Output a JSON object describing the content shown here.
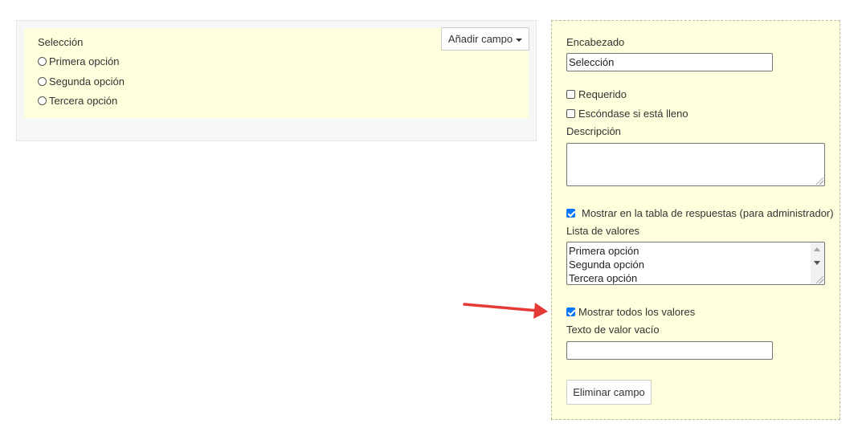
{
  "preview": {
    "title": "Selección",
    "options": [
      "Primera opción",
      "Segunda opción",
      "Tercera opción"
    ],
    "add_field_label": "Añadir campo"
  },
  "editor": {
    "heading_label": "Encabezado",
    "heading_value": "Selección",
    "required_label": "Requerido",
    "required_checked": false,
    "hide_if_filled_label": "Escóndase si está lleno",
    "hide_if_filled_checked": false,
    "description_label": "Descripción",
    "description_value": "",
    "show_in_table_label": "Mostrar en la tabla de respuestas (para administrador)",
    "show_in_table_checked": true,
    "value_list_label": "Lista de valores",
    "value_list": [
      "Primera opción",
      "Segunda opción",
      "Tercera opción"
    ],
    "show_all_values_label": "Mostrar todos los valores",
    "show_all_values_checked": true,
    "empty_value_text_label": "Texto de valor vacío",
    "empty_value_text_value": "",
    "delete_label": "Eliminar campo"
  },
  "colors": {
    "panel_yellow": "#ffffdd",
    "checkbox_blue": "#0075ff",
    "annotation_arrow": "#e53935"
  },
  "icons": [
    "caret-down-icon",
    "radio-icon",
    "checkbox-icon",
    "scroll-up-icon",
    "scroll-down-icon",
    "resize-grip-icon",
    "annotation-arrow-icon"
  ]
}
